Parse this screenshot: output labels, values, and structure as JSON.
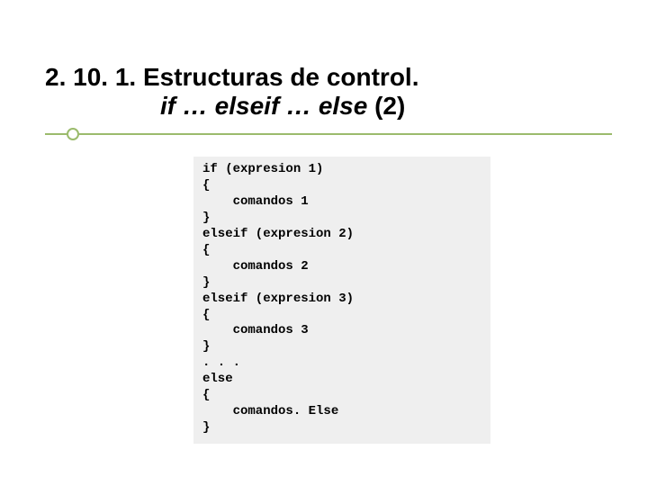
{
  "title": {
    "line1": "2. 10. 1. Estructuras de control.",
    "line2_italic": "if … elseif … else",
    "line2_suffix": " (2)"
  },
  "code": {
    "l1": "if (expresion 1)",
    "l2": "{",
    "l3": "    comandos 1",
    "l4": "}",
    "l5": "elseif (expresion 2)",
    "l6": "{",
    "l7": "    comandos 2",
    "l8": "}",
    "l9": "elseif (expresion 3)",
    "l10": "{",
    "l11": "    comandos 3",
    "l12": "}",
    "l13": ". . .",
    "l14": "else",
    "l15": "{",
    "l16": "    comandos. Else",
    "l17": "}"
  }
}
